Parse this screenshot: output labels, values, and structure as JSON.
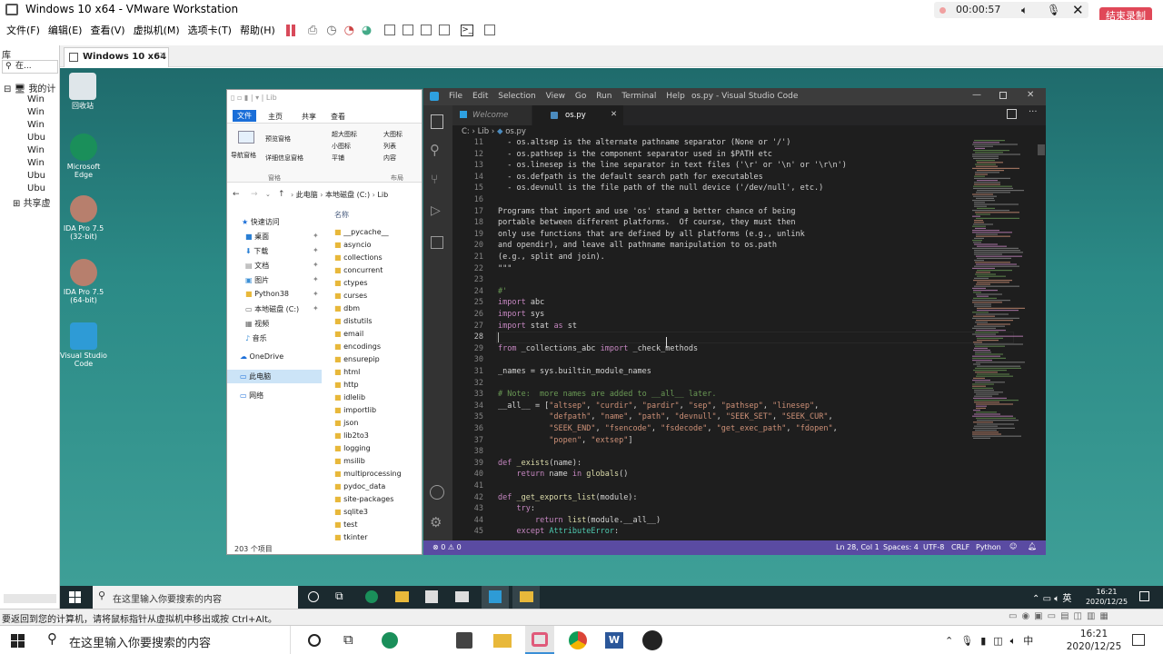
{
  "vmware": {
    "title": "Windows 10 x64 - VMware Workstation",
    "timer": "00:00:57",
    "end_recording": "结束录制",
    "menu": [
      "文件(F)",
      "编辑(E)",
      "查看(V)",
      "虚拟机(M)",
      "选项卡(T)",
      "帮助(H)"
    ],
    "library_title": "库",
    "library_search": "在...",
    "library_root": "我的计",
    "library_items": [
      "Win",
      "Win",
      "Win",
      "Ubu",
      "Win",
      "Win",
      "Ubu",
      "Ubu"
    ],
    "library_shared": "共享虚",
    "vm_tab": "Windows 10 x64",
    "status_text": "要返回到您的计算机，请将鼠标指针从虚拟机中移出或按 Ctrl+Alt。"
  },
  "desktop_icons": [
    {
      "label": "回收站",
      "color": "#dfe6ea"
    },
    {
      "label": "Microsoft Edge",
      "color": "#1a8f5a"
    },
    {
      "label": "IDA Pro 7.5 (32-bit)",
      "color": "#b77f6d"
    },
    {
      "label": "IDA Pro 7.5 (64-bit)",
      "color": "#b77f6d"
    },
    {
      "label": "Visual Studio Code",
      "color": "#2e9bd6"
    }
  ],
  "explorer": {
    "title": "Lib",
    "ribbon_tabs": [
      "文件",
      "主页",
      "共享",
      "查看"
    ],
    "pane_buttons": [
      "导航窗格",
      "预览窗格",
      "详细信息窗格"
    ],
    "layout_buttons": [
      "超大图标",
      "大图标",
      "小图标",
      "列表",
      "平铺",
      "内容"
    ],
    "group_pane": "窗格",
    "group_layout": "布局",
    "path": [
      "此电脑",
      "本地磁盘 (C:)",
      "Lib"
    ],
    "nav": [
      {
        "label": "快速访问",
        "pinned": false
      },
      {
        "label": "桌面",
        "pinned": true
      },
      {
        "label": "下载",
        "pinned": true
      },
      {
        "label": "文档",
        "pinned": true
      },
      {
        "label": "图片",
        "pinned": true
      },
      {
        "label": "Python38",
        "pinned": true
      },
      {
        "label": "本地磁盘 (C:)",
        "pinned": true
      },
      {
        "label": "视频",
        "pinned": false
      },
      {
        "label": "音乐",
        "pinned": false
      },
      {
        "label": "OneDrive",
        "pinned": false
      },
      {
        "label": "此电脑",
        "pinned": false
      },
      {
        "label": "网络",
        "pinned": false
      }
    ],
    "column_header": "名称",
    "files": [
      "__pycache__",
      "asyncio",
      "collections",
      "concurrent",
      "ctypes",
      "curses",
      "dbm",
      "distutils",
      "email",
      "encodings",
      "ensurepip",
      "html",
      "http",
      "idlelib",
      "importlib",
      "json",
      "lib2to3",
      "logging",
      "msilib",
      "multiprocessing",
      "pydoc_data",
      "site-packages",
      "sqlite3",
      "test",
      "tkinter"
    ],
    "status": "203 个项目"
  },
  "vscode": {
    "menu": [
      "File",
      "Edit",
      "Selection",
      "View",
      "Go",
      "Run",
      "Terminal",
      "Help"
    ],
    "title": "os.py - Visual Studio Code",
    "tabs": [
      "Welcome",
      "os.py"
    ],
    "breadcrumb": [
      "C:",
      "Lib",
      "os.py"
    ],
    "line_numbers": [
      "11",
      "12",
      "13",
      "14",
      "15",
      "16",
      "17",
      "18",
      "19",
      "20",
      "21",
      "22",
      "23",
      "24",
      "25",
      "26",
      "27",
      "28",
      "29",
      "30",
      "31",
      "32",
      "33",
      "34",
      "35",
      "36",
      "37",
      "38",
      "39",
      "40",
      "41",
      "42",
      "43",
      "44",
      "45"
    ],
    "code": [
      "  - os.altsep is the alternate pathname separator (None or '/')",
      "  - os.pathsep is the component separator used in $PATH etc",
      "  - os.linesep is the line separator in text files ('\\r' or '\\n' or '\\r\\n')",
      "  - os.defpath is the default search path for executables",
      "  - os.devnull is the file path of the null device ('/dev/null', etc.)",
      "",
      "Programs that import and use 'os' stand a better chance of being",
      "portable between different platforms.  Of course, they must then",
      "only use functions that are defined by all platforms (e.g., unlink",
      "and opendir), and leave all pathname manipulation to os.path",
      "(e.g., split and join).",
      "\"\"\"",
      "",
      "#'",
      "import abc",
      "import sys",
      "import stat as st",
      "",
      "from _collections_abc import _check_methods",
      "",
      "_names = sys.builtin_module_names",
      "",
      "# Note:  more names are added to __all__ later.",
      "__all__ = [\"altsep\", \"curdir\", \"pardir\", \"sep\", \"pathsep\", \"linesep\",",
      "           \"defpath\", \"name\", \"path\", \"devnull\", \"SEEK_SET\", \"SEEK_CUR\",",
      "           \"SEEK_END\", \"fsencode\", \"fsdecode\", \"get_exec_path\", \"fdopen\",",
      "           \"popen\", \"extsep\"]",
      "",
      "def _exists(name):",
      "    return name in globals()",
      "",
      "def _get_exports_list(module):",
      "    try:",
      "        return list(module.__all__)",
      "    except AttributeError:"
    ],
    "status_left": {
      "errors": "0",
      "warnings": "0"
    },
    "status_right": [
      "Ln 28, Col 1",
      "Spaces: 4",
      "UTF-8",
      "CRLF",
      "Python"
    ]
  },
  "guest_taskbar": {
    "search_placeholder": "在这里输入你要搜索的内容",
    "ime": "英",
    "time": "16:21",
    "date": "2020/12/25"
  },
  "host_taskbar": {
    "search_placeholder": "在这里输入你要搜索的内容",
    "ime": "中",
    "time": "16:21",
    "date": "2020/12/25"
  }
}
